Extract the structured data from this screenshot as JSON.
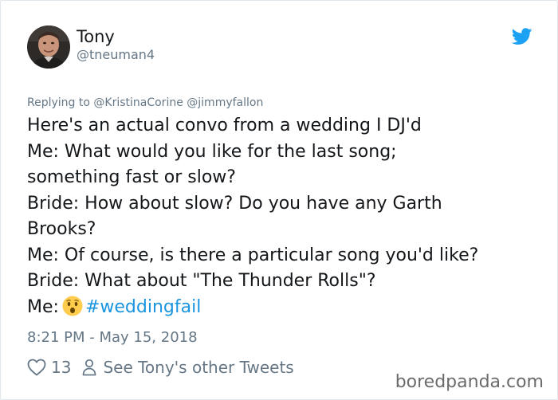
{
  "author": {
    "display_name": "Tony",
    "handle": "@tneuman4"
  },
  "reply": {
    "prefix": "Replying to",
    "mentions": [
      "@KristinaCorine",
      "@jimmyfallon"
    ]
  },
  "tweet": {
    "lines": [
      "Here's an actual convo from a wedding I DJ'd",
      "Me: What would you like for the last song;",
      "something fast or slow?",
      "Bride: How about slow? Do you have any Garth",
      "Brooks?",
      "Me: Of course, is there a particular song you'd like?",
      "Bride: What about \"The Thunder Rolls\"?"
    ],
    "last_line_prefix": "Me:",
    "hashtag": "#weddingfail"
  },
  "timestamp": "8:21 PM - May 15, 2018",
  "actions": {
    "like_count": "13",
    "other_tweets_label": "See Tony's other Tweets"
  },
  "watermark": "boredpanda.com",
  "colors": {
    "text": "#14171a",
    "secondary": "#657786",
    "link": "#1b95e0",
    "twitter_blue": "#1da1f2"
  },
  "icons": {
    "bird": "twitter-bird-icon",
    "emoji": "astonished-face-emoji",
    "heart": "heart-icon",
    "person": "person-icon"
  }
}
